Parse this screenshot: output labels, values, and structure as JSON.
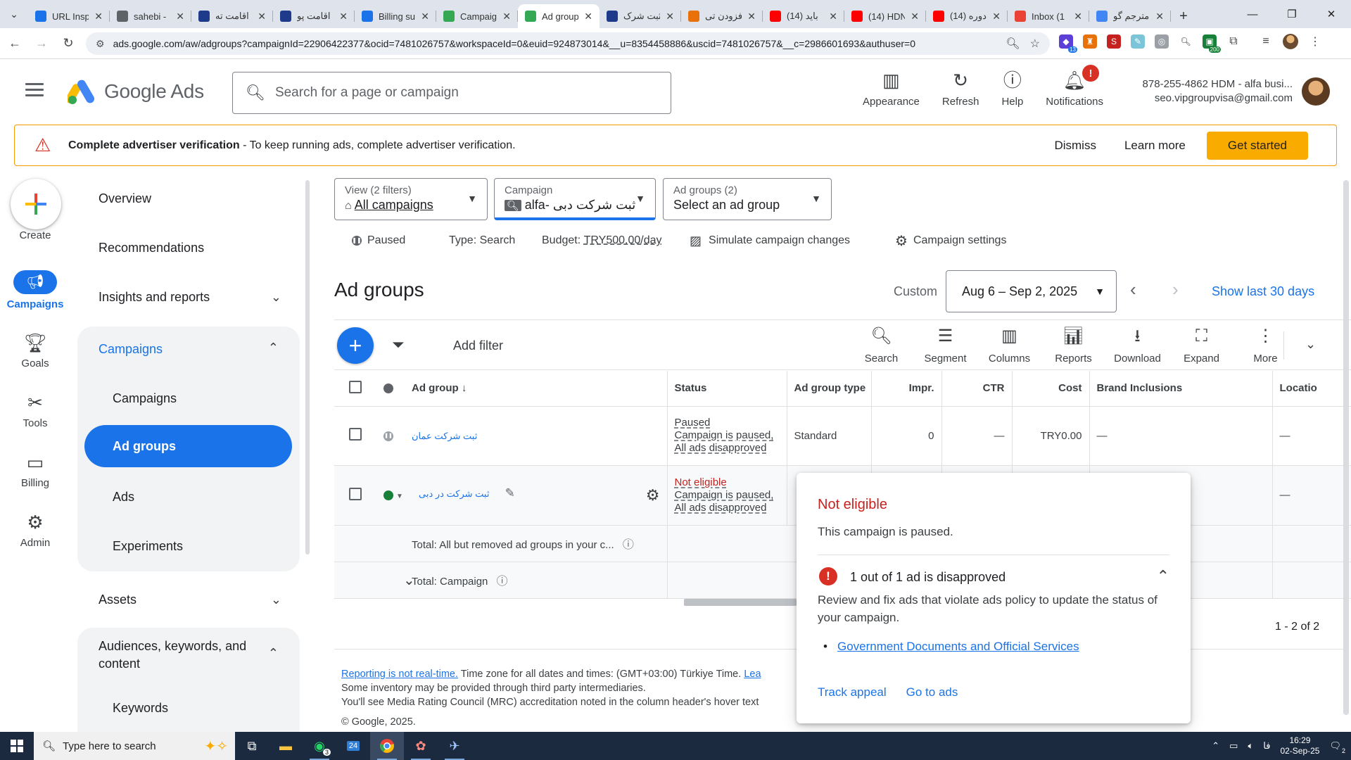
{
  "browser": {
    "tabs": [
      {
        "title": "URL Insp",
        "color": "#1a73e8",
        "active": false
      },
      {
        "title": "sahebi -",
        "color": "#5f6368",
        "active": false
      },
      {
        "title": "اقامت ته",
        "color": "#1e3a8a",
        "active": false
      },
      {
        "title": "اقامت پو",
        "color": "#1e3a8a",
        "active": false
      },
      {
        "title": "Billing su",
        "color": "#1a73e8",
        "active": false
      },
      {
        "title": "Campaig",
        "color": "#34a853",
        "active": false
      },
      {
        "title": "Ad group",
        "color": "#34a853",
        "active": true
      },
      {
        "title": "ثبت شرک",
        "color": "#1e3a8a",
        "active": false
      },
      {
        "title": "افزودن تی",
        "color": "#e8710a",
        "active": false
      },
      {
        "title": "(14) باید",
        "color": "#ff0000",
        "active": false
      },
      {
        "title": "(14) HDN",
        "color": "#ff0000",
        "active": false
      },
      {
        "title": "(14) دوره",
        "color": "#ff0000",
        "active": false
      },
      {
        "title": "Inbox (1",
        "color": "#ea4335",
        "active": false
      },
      {
        "title": "مترجم گو",
        "color": "#4285f4",
        "active": false
      }
    ],
    "url": "ads.google.com/aw/adgroups?campaignId=22906422377&ocid=7481026757&workspaceId=0&euid=924873014&__u=8354458886&uscid=7481026757&__c=2986601693&authuser=0",
    "ext_badges": {
      "e1": "13",
      "e2": "200"
    }
  },
  "header": {
    "brand": "Google Ads",
    "search_placeholder": "Search for a page or campaign",
    "actions": {
      "appearance": "Appearance",
      "refresh": "Refresh",
      "help": "Help",
      "notifications": "Notifications"
    },
    "notif_badge": "!",
    "account_line1": "878-255-4862 HDM - alfa busi...",
    "account_line2": "seo.vipgroupvisa@gmail.com"
  },
  "banner": {
    "title": "Complete advertiser verification",
    "text": " - To keep running ads, complete advertiser verification.",
    "dismiss": "Dismiss",
    "learn_more": "Learn more",
    "get_started": "Get started"
  },
  "rail": {
    "create": "Create",
    "campaigns": "Campaigns",
    "goals": "Goals",
    "tools": "Tools",
    "billing": "Billing",
    "admin": "Admin"
  },
  "sidenav": {
    "overview": "Overview",
    "recommendations": "Recommendations",
    "insights": "Insights and reports",
    "campaigns_group": "Campaigns",
    "campaigns": "Campaigns",
    "ad_groups": "Ad groups",
    "ads": "Ads",
    "experiments": "Experiments",
    "assets": "Assets",
    "audiences_l1": "Audiences, keywords, and",
    "audiences_l2": "content",
    "keywords": "Keywords"
  },
  "selectors": {
    "view_cap": "View (2 filters)",
    "view_val": "All campaigns",
    "camp_cap": "Campaign",
    "camp_val": "alfa- ثبت شرکت دبی",
    "adg_cap": "Ad groups (2)",
    "adg_val": "Select an ad group"
  },
  "statusbar": {
    "status": "Paused",
    "type_label": "Type:",
    "type_val": "Search",
    "budget_label": "Budget:",
    "budget_val": "TRY500.00/day",
    "simulate": "Simulate campaign changes",
    "settings": "Campaign settings"
  },
  "main": {
    "title": "Ad groups",
    "custom": "Custom",
    "date_range": "Aug 6 – Sep 2, 2025",
    "show_last": "Show last 30 days",
    "add_filter": "Add filter",
    "tools": {
      "search": "Search",
      "segment": "Segment",
      "columns": "Columns",
      "reports": "Reports",
      "download": "Download",
      "expand": "Expand",
      "more": "More"
    }
  },
  "table": {
    "headers": {
      "ad_group": "Ad group",
      "status": "Status",
      "type": "Ad group type",
      "impr": "Impr.",
      "ctr": "CTR",
      "cost": "Cost",
      "brand": "Brand Inclusions",
      "location": "Locatio"
    },
    "rows": [
      {
        "name": "ثبت شرکت عمان",
        "status": "Paused",
        "status_sub1": "Campaign is paused,",
        "status_sub2": "All ads disapproved",
        "type": "Standard",
        "impr": "0",
        "ctr": "—",
        "cost": "TRY0.00",
        "brand": "—",
        "location": "—"
      },
      {
        "name": "ثبت شرکت در دبی",
        "status": "Not eligible",
        "status_sub1": "Campaign is paused,",
        "status_sub2": "All ads disapproved",
        "location": "—"
      }
    ],
    "total_all": "Total: All but removed ad groups in your c...",
    "total_campaign": "Total: Campaign",
    "pager": "1 - 2 of 2"
  },
  "footer": {
    "realtime_link": "Reporting is not real-time.",
    "tz": " Time zone for all dates and times: (GMT+03:00) Türkiye Time. ",
    "tz_link": "Lea",
    "line2": "Some inventory may be provided through third party intermediaries.",
    "line3": "You'll see Media Rating Council (MRC) accreditation noted in the column header's hover text",
    "copyright": "© Google, 2025."
  },
  "popover": {
    "title": "Not eligible",
    "subtitle": "This campaign is paused.",
    "issue": "1 out of 1 ad is disapproved",
    "body": "Review and fix ads that violate ads policy to update the status of your campaign.",
    "policy_link": "Government Documents and Official Services",
    "track_appeal": "Track appeal",
    "go_to_ads": "Go to ads"
  },
  "taskbar": {
    "search": "Type here to search",
    "whatsapp_badge": "3",
    "calendar_num": "24",
    "lang": "فا",
    "time": "16:29",
    "date": "02-Sep-25",
    "notif_count": "2"
  },
  "colors": {
    "accent": "#1a73e8",
    "warning": "#f9ab00",
    "error": "#c5221f",
    "enabled": "#188038"
  }
}
